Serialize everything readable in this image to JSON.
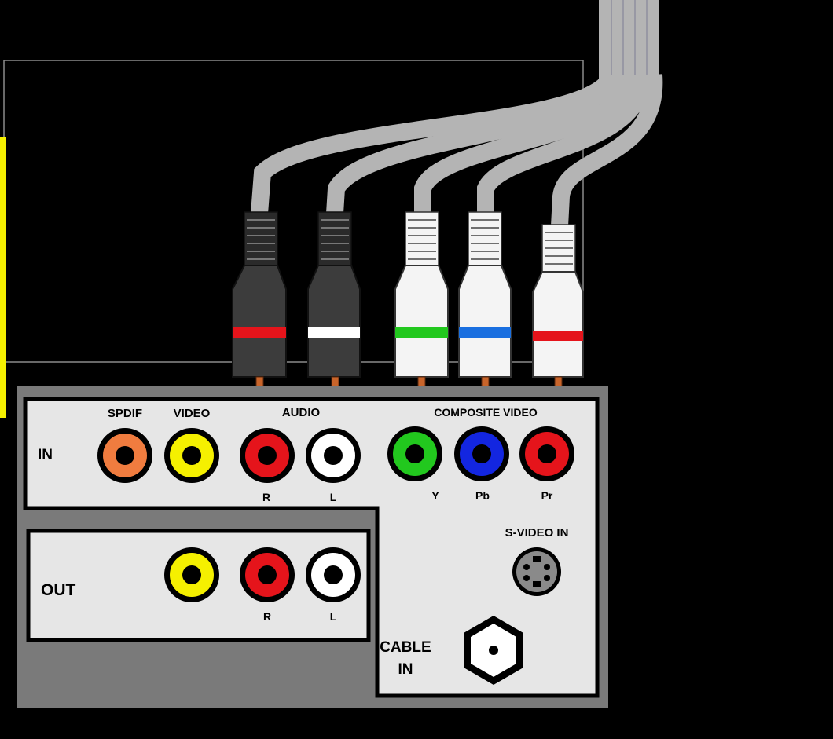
{
  "panel": {
    "in_label": "IN",
    "out_label": "OUT",
    "spdif_label": "SPDIF",
    "video_label": "VIDEO",
    "audio_label": "AUDIO",
    "composite_label": "COMPOSITE VIDEO",
    "svideo_label": "S-VIDEO IN",
    "cable_label_line1": "CABLE",
    "cable_label_line2": "IN",
    "in_sub": {
      "audio_r": "R",
      "audio_l": "L",
      "y": "Y",
      "pb": "Pb",
      "pr": "Pr"
    },
    "out_sub": {
      "r": "R",
      "l": "L"
    }
  },
  "colors": {
    "background": "#000000",
    "panel": "#e6e6e6",
    "panel_shadow": "#7a7a7a",
    "spdif": "#f07c3f",
    "yellow": "#f5f000",
    "red": "#e5141b",
    "white": "#ffffff",
    "green": "#22c81e",
    "blue": "#1326e0",
    "cable": "#b4b4b4",
    "plug_black": "#3c3c3c",
    "plug_white": "#f4f4f4",
    "tv_screen_border": "#f5f000"
  },
  "plugs": [
    {
      "name": "audio-right-plug",
      "body": "black",
      "band": "red"
    },
    {
      "name": "audio-left-plug",
      "body": "black",
      "band": "white"
    },
    {
      "name": "y-plug",
      "body": "white",
      "band": "green"
    },
    {
      "name": "pb-plug",
      "body": "white",
      "band": "blue"
    },
    {
      "name": "pr-plug",
      "body": "white",
      "band": "red"
    }
  ]
}
